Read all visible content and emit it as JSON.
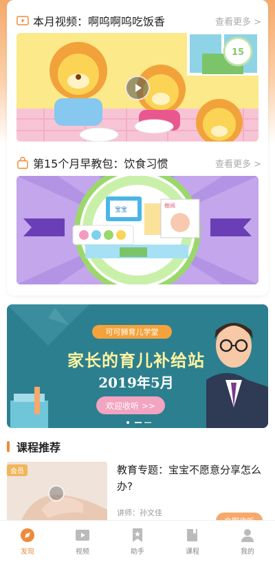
{
  "section1": {
    "title": "本月视频：啊呜啊呜吃饭香",
    "more": "查看更多 >",
    "badge": "15"
  },
  "section2": {
    "title": "第15个月早教包：饮食习惯",
    "more": "查看更多 >"
  },
  "product_labels": {
    "box": "宝宝",
    "book": "樹阅"
  },
  "ad": {
    "subtitle": "可可狮育儿学堂",
    "title": "家长的育儿补给站",
    "date": "2019年5月",
    "button": "欢迎收听 >>"
  },
  "courses": {
    "header": "课程推荐",
    "items": [
      {
        "badge": "会员",
        "title": "教育专题：宝宝不愿意分享怎么办?",
        "teacher": "讲师：孙文佳",
        "action": "立即收听"
      }
    ]
  },
  "tabs": [
    {
      "label": "发现",
      "icon": "discover-icon",
      "active": true
    },
    {
      "label": "视频",
      "icon": "video-icon",
      "active": false
    },
    {
      "label": "助手",
      "icon": "bookmark-icon",
      "active": false
    },
    {
      "label": "课程",
      "icon": "book-icon",
      "active": false
    },
    {
      "label": "我的",
      "icon": "profile-icon",
      "active": false
    }
  ],
  "colors": {
    "accent": "#f08a3b",
    "topBackground": "#f6a96a"
  }
}
